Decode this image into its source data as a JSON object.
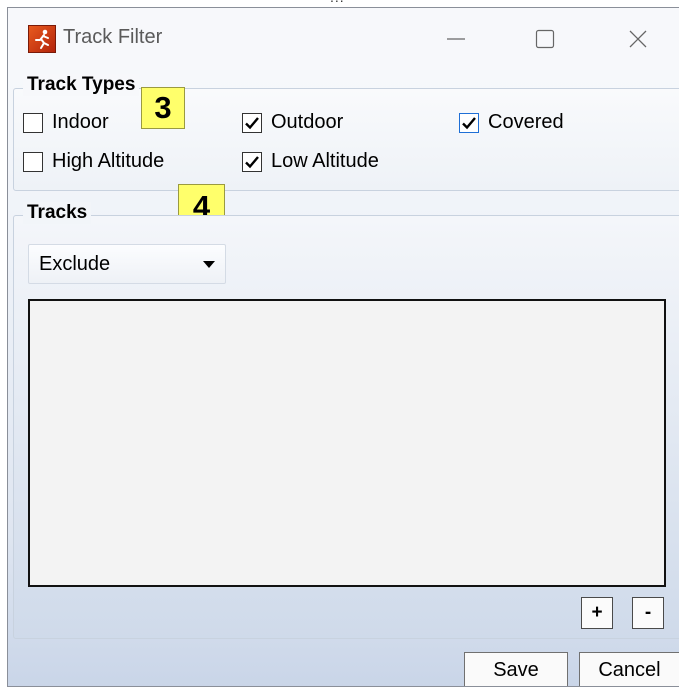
{
  "background_hint": "...",
  "window": {
    "title": "Track Filter",
    "icon": "runner-app-icon",
    "controls": [
      "minimize-icon",
      "maximize-icon",
      "close-icon"
    ]
  },
  "track_types": {
    "legend": "Track Types",
    "options": [
      {
        "label": "Indoor",
        "checked": false
      },
      {
        "label": "Outdoor",
        "checked": true
      },
      {
        "label": "Covered",
        "checked": true,
        "focused": true
      },
      {
        "label": "High Altitude",
        "checked": false
      },
      {
        "label": "Low Altitude",
        "checked": true
      }
    ]
  },
  "annotations": {
    "badge_3": "3",
    "badge_4": "4"
  },
  "tracks": {
    "legend": "Tracks",
    "mode_selected": "Exclude",
    "items": [],
    "add_label": "+",
    "remove_label": "-"
  },
  "footer": {
    "save_label": "Save",
    "cancel_label": "Cancel"
  },
  "colors": {
    "badge": "#ffff6b",
    "focus_checkbox": "#1f6fd6",
    "gradient_bottom": "#c9d5e8"
  }
}
